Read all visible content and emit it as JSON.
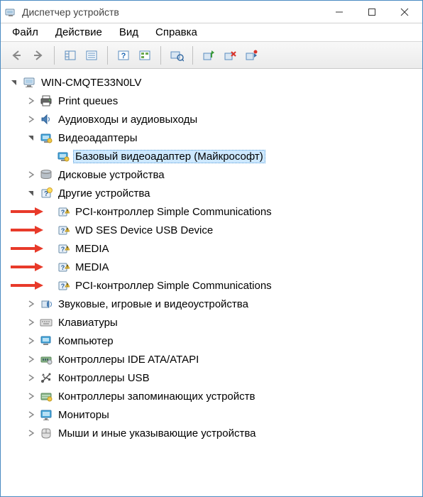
{
  "titlebar": {
    "title": "Диспетчер устройств"
  },
  "menu": {
    "items": [
      "Файл",
      "Действие",
      "Вид",
      "Справка"
    ]
  },
  "tree": {
    "root": {
      "label": "WIN-CMQTE33N0LV",
      "icon": "computer-icon",
      "expanded": true,
      "children": [
        {
          "label": "Print queues",
          "icon": "printer-icon",
          "expanded": false,
          "hasChildren": true
        },
        {
          "label": "Аудиовходы и аудиовыходы",
          "icon": "speaker-icon",
          "expanded": false,
          "hasChildren": true
        },
        {
          "label": "Видеоадаптеры",
          "icon": "display-adapter-icon",
          "expanded": true,
          "hasChildren": true,
          "children": [
            {
              "label": "Базовый видеоадаптер (Майкрософт)",
              "icon": "display-adapter-icon",
              "selected": true
            }
          ]
        },
        {
          "label": "Дисковые устройства",
          "icon": "disk-icon",
          "expanded": false,
          "hasChildren": true
        },
        {
          "label": "Другие устройства",
          "icon": "unknown-category-icon",
          "expanded": true,
          "hasChildren": true,
          "children": [
            {
              "label": "PCI-контроллер Simple Communications",
              "icon": "unknown-device-icon",
              "highlight": true
            },
            {
              "label": "WD SES Device USB Device",
              "icon": "unknown-device-icon",
              "highlight": true
            },
            {
              "label": "MEDIA",
              "icon": "unknown-device-icon",
              "highlight": true
            },
            {
              "label": "MEDIA",
              "icon": "unknown-device-icon",
              "highlight": true
            },
            {
              "label": "PCI-контроллер Simple Communications",
              "icon": "unknown-device-icon",
              "highlight": true
            }
          ]
        },
        {
          "label": "Звуковые, игровые и видеоустройства",
          "icon": "sound-icon",
          "expanded": false,
          "hasChildren": true
        },
        {
          "label": "Клавиатуры",
          "icon": "keyboard-icon",
          "expanded": false,
          "hasChildren": true
        },
        {
          "label": "Компьютер",
          "icon": "computer-category-icon",
          "expanded": false,
          "hasChildren": true
        },
        {
          "label": "Контроллеры IDE ATA/ATAPI",
          "icon": "ide-icon",
          "expanded": false,
          "hasChildren": true
        },
        {
          "label": "Контроллеры USB",
          "icon": "usb-icon",
          "expanded": false,
          "hasChildren": true
        },
        {
          "label": "Контроллеры запоминающих устройств",
          "icon": "storage-controller-icon",
          "expanded": false,
          "hasChildren": true
        },
        {
          "label": "Мониторы",
          "icon": "monitor-icon",
          "expanded": false,
          "hasChildren": true
        },
        {
          "label": "Мыши и иные указывающие устройства",
          "icon": "mouse-icon",
          "expanded": false,
          "hasChildren": true
        }
      ]
    }
  }
}
